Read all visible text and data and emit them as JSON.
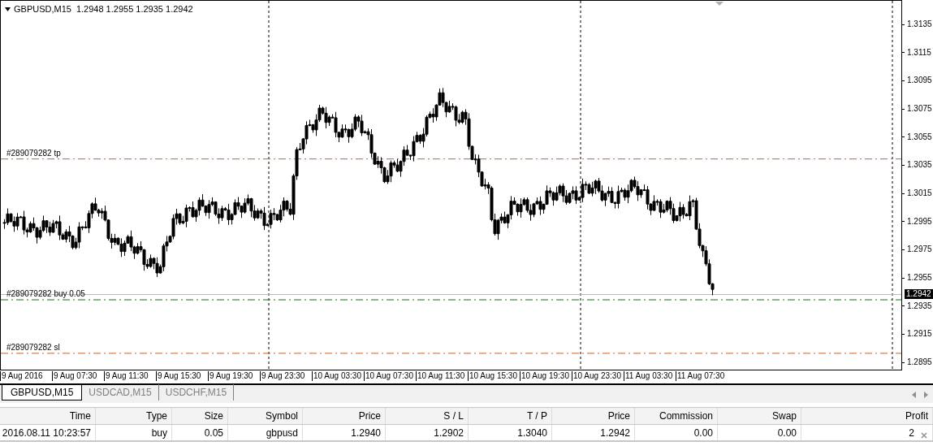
{
  "chart": {
    "header": {
      "symbol": "GBPUSD,M15",
      "ohlc": "1.2948 1.2955 1.2935 1.2942"
    },
    "order_lines": [
      {
        "kind": "tp",
        "label": "#289079282 tp"
      },
      {
        "kind": "open",
        "label": "#289079282 buy 0.05"
      },
      {
        "kind": "sl",
        "label": "#289079282 sl"
      }
    ],
    "price_axis": [
      "1.3135",
      "1.3115",
      "1.3095",
      "1.3075",
      "1.3055",
      "1.3035",
      "1.3015",
      "1.2995",
      "1.2975",
      "1.2955",
      "1.2935",
      "1.2915",
      "1.2895"
    ],
    "current_price": "1.2942",
    "time_axis": [
      "9 Aug 2016",
      "9 Aug 07:30",
      "9 Aug 11:30",
      "9 Aug 15:30",
      "9 Aug 19:30",
      "9 Aug 23:30",
      "10 Aug 03:30",
      "10 Aug 07:30",
      "10 Aug 11:30",
      "10 Aug 15:30",
      "10 Aug 19:30",
      "10 Aug 23:30",
      "11 Aug 03:30",
      "11 Aug 07:30"
    ]
  },
  "chart_tabs": [
    {
      "label": "GBPUSD,M15",
      "selected": true
    },
    {
      "label": "USDCAD,M15",
      "selected": false
    },
    {
      "label": "USDCHF,M15",
      "selected": false
    }
  ],
  "table": {
    "columns": [
      "Time",
      "Type",
      "Size",
      "Symbol",
      "Price",
      "S / L",
      "T / P",
      "Price",
      "Commission",
      "Swap",
      "Profit"
    ],
    "rows": [
      [
        "2016.08.11 10:23:57",
        "buy",
        "0.05",
        "gbpusd",
        "1.2940",
        "1.2902",
        "1.3040",
        "1.2942",
        "0.00",
        "0.00",
        "2"
      ]
    ]
  }
}
